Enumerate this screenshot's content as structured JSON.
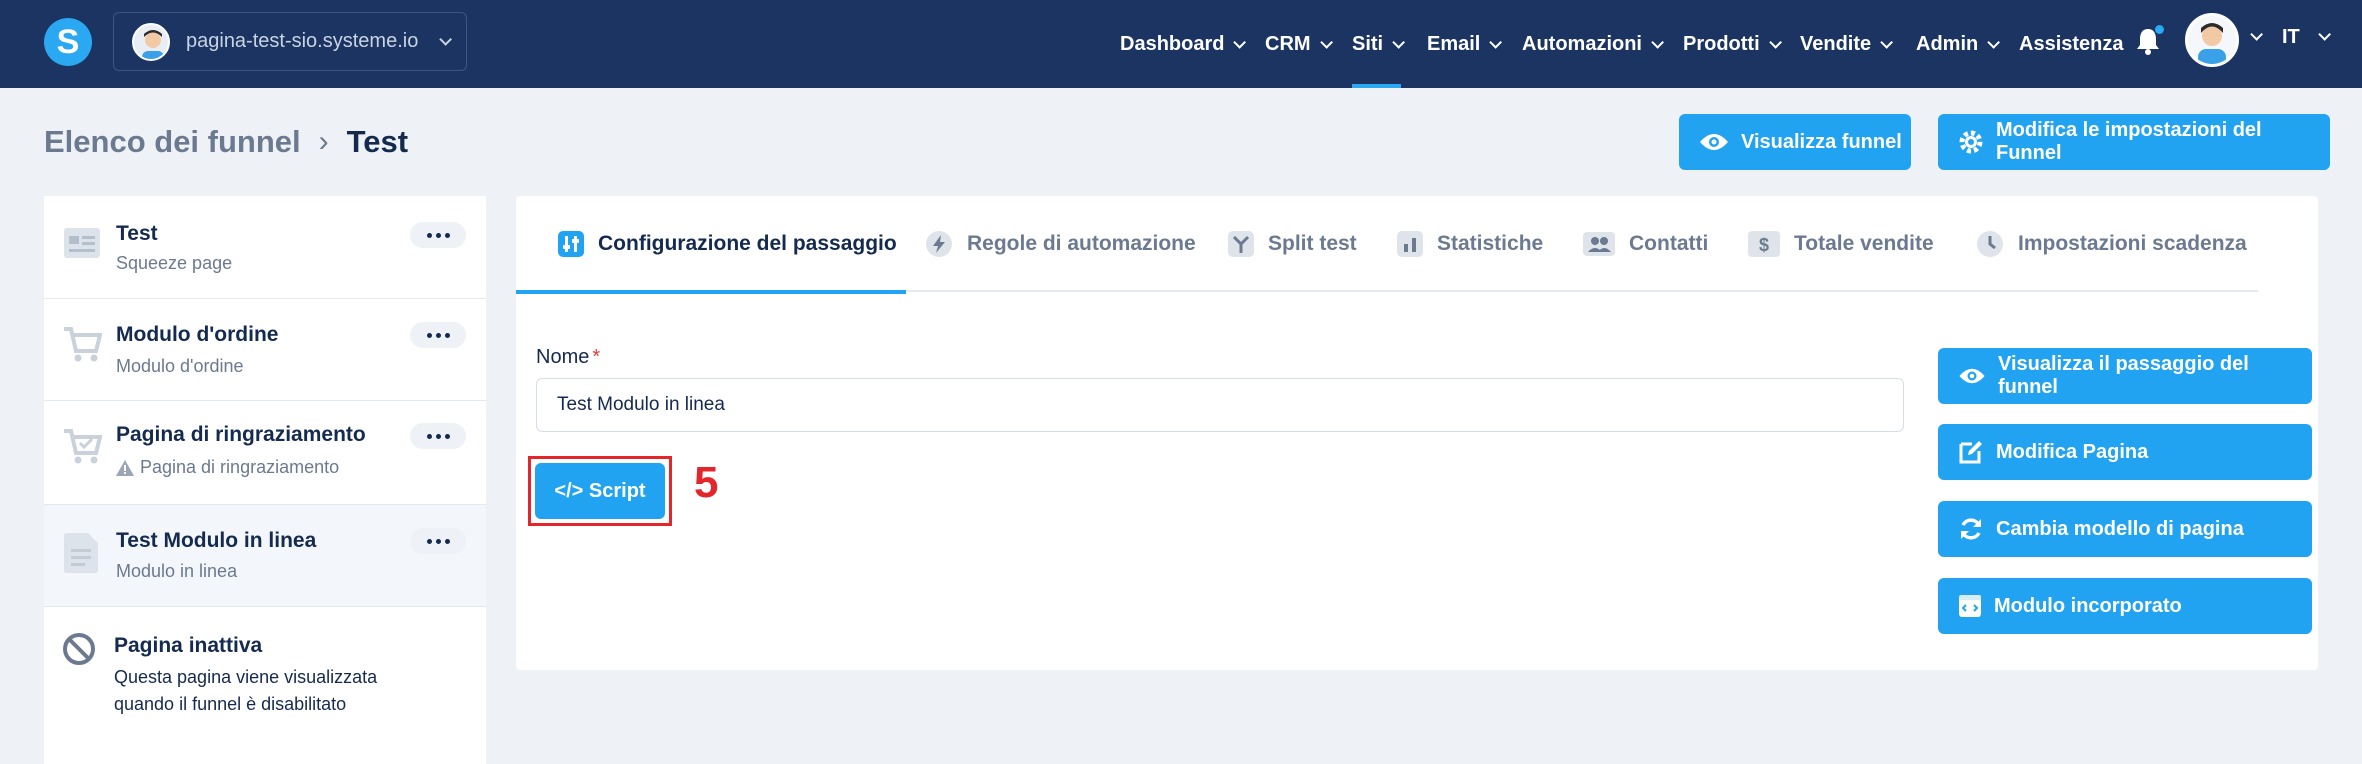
{
  "header": {
    "logo": "S",
    "site_domain": "pagina-test-sio.systeme.io",
    "nav": [
      {
        "label": "Dashboard"
      },
      {
        "label": "CRM"
      },
      {
        "label": "Siti"
      },
      {
        "label": "Email"
      },
      {
        "label": "Automazioni"
      },
      {
        "label": "Prodotti"
      },
      {
        "label": "Vendite"
      },
      {
        "label": "Admin"
      },
      {
        "label": "Assistenza"
      }
    ],
    "active_nav": "Siti",
    "language": "IT"
  },
  "breadcrumb": {
    "parent": "Elenco dei funnel",
    "current": "Test"
  },
  "top_actions": {
    "view_funnel": "Visualizza funnel",
    "edit_settings": "Modifica le impostazioni del Funnel"
  },
  "sidebar": {
    "steps": [
      {
        "title": "Test",
        "subtitle": "Squeeze page"
      },
      {
        "title": "Modulo d'ordine",
        "subtitle": "Modulo d'ordine"
      },
      {
        "title": "Pagina di ringraziamento",
        "subtitle": "Pagina di ringraziamento"
      },
      {
        "title": "Test Modulo in linea",
        "subtitle": "Modulo in linea"
      }
    ],
    "inactive": {
      "title": "Pagina inattiva",
      "description": "Questa pagina viene visualizzata quando il funnel è disabilitato"
    }
  },
  "tabs": [
    {
      "label": "Configurazione del passaggio"
    },
    {
      "label": "Regole di automazione"
    },
    {
      "label": "Split test"
    },
    {
      "label": "Statistiche"
    },
    {
      "label": "Contatti"
    },
    {
      "label": "Totale vendite"
    },
    {
      "label": "Impostazioni scadenza"
    }
  ],
  "form": {
    "name_label": "Nome",
    "required_mark": "*",
    "name_value": "Test Modulo in linea",
    "script_button": "</> Script",
    "annotation": "5"
  },
  "side_actions": {
    "view_step": "Visualizza il passaggio del funnel",
    "edit_page": "Modifica Pagina",
    "change_template": "Cambia modello di pagina",
    "embedded_form": "Modulo incorporato"
  },
  "colors": {
    "navbar": "#1b3461",
    "accent": "#21a3f1",
    "annotation": "#e3262b",
    "text_dark": "#142a4f",
    "text_muted": "#6b7a90"
  }
}
